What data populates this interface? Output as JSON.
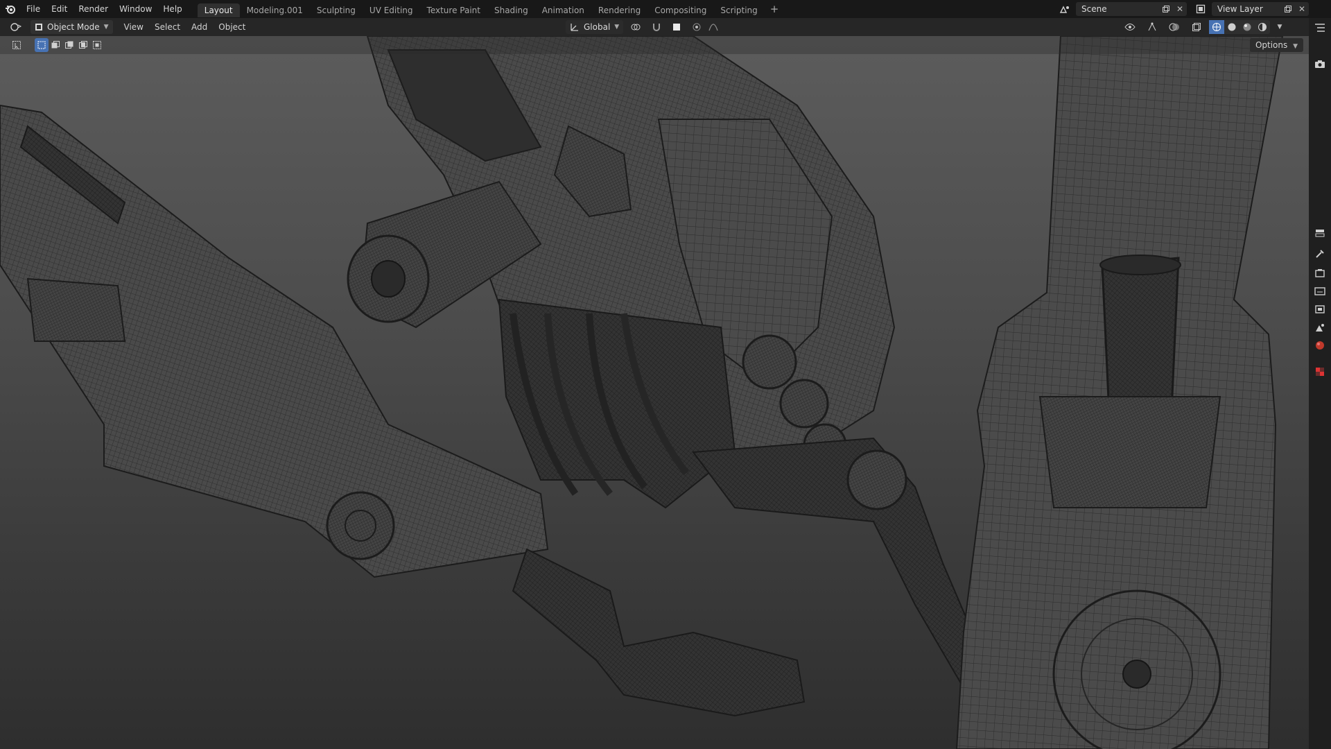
{
  "app": {
    "logo_icon": "blender-logo-icon",
    "menus": [
      "File",
      "Edit",
      "Render",
      "Window",
      "Help"
    ],
    "workspaces": [
      "Layout",
      "Modeling.001",
      "Sculpting",
      "UV Editing",
      "Texture Paint",
      "Shading",
      "Animation",
      "Rendering",
      "Compositing",
      "Scripting"
    ],
    "active_workspace": "Layout",
    "add_workspace": "+",
    "scene_name": "Scene",
    "view_layer_name": "View Layer"
  },
  "viewport_header": {
    "mode": "Object Mode",
    "menus": [
      "View",
      "Select",
      "Add",
      "Object"
    ],
    "transform_orientation": "Global",
    "shading_mode": "wireframe"
  },
  "toolbar": {
    "options_label": "Options"
  },
  "colors": {
    "accent": "#4772b3",
    "topbar": "#181818",
    "header": "#262626",
    "mesh": "#2a2a2a"
  },
  "right_icons": [
    "camera-icon",
    "tool-icon",
    "render-icon",
    "output-icon",
    "view-layer-icon",
    "scene-icon",
    "world-icon",
    "texture-icon"
  ]
}
